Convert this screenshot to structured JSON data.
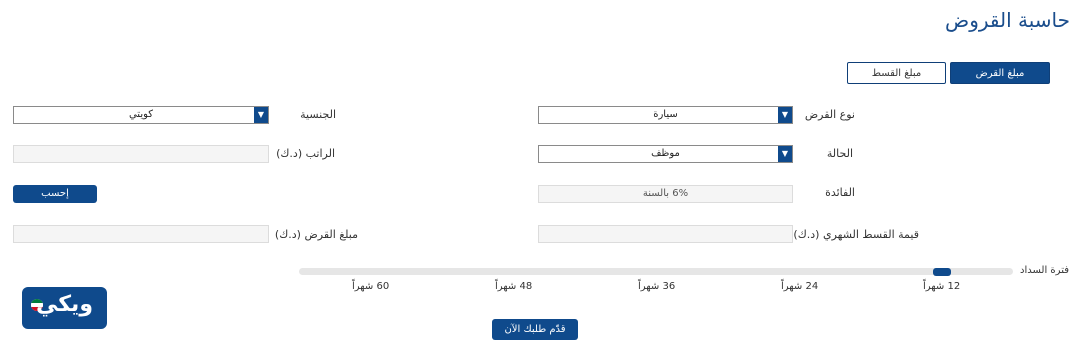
{
  "page": {
    "title": "حاسبة القروض"
  },
  "tabs": [
    {
      "label": "مبلغ القرض",
      "active": true
    },
    {
      "label": "مبلغ القسط",
      "active": false
    }
  ],
  "form": {
    "loan_type": {
      "label": "نوع القرض",
      "value": "سيارة"
    },
    "nationality": {
      "label": "الجنسية",
      "value": "كويتي"
    },
    "status": {
      "label": "الحالة",
      "value": "موظف"
    },
    "salary": {
      "label": "الراتب (د.ك)",
      "value": ""
    },
    "interest": {
      "label": "الفائدة",
      "value": "6% بالسنة"
    },
    "calculate_button": "إحسب",
    "monthly_installment": {
      "label": "قيمة القسط الشهري (د.ك)",
      "value": ""
    },
    "loan_amount": {
      "label": "مبلغ القرض (د.ك)",
      "value": ""
    }
  },
  "slider": {
    "label": "فترة السداد",
    "ticks": [
      "12 شهراً",
      "24 شهراً",
      "36 شهراً",
      "48 شهراً",
      "60 شهراً"
    ],
    "selected": "12 شهراً"
  },
  "submit_button": "قدّم طلبك الآن",
  "logo": {
    "text": "ويكي",
    "icon": "kuwait-flag-dot-icon"
  },
  "colors": {
    "accent": "#0f4a8c",
    "title": "#1a4d8c",
    "field_bg": "#f5f5f5"
  }
}
